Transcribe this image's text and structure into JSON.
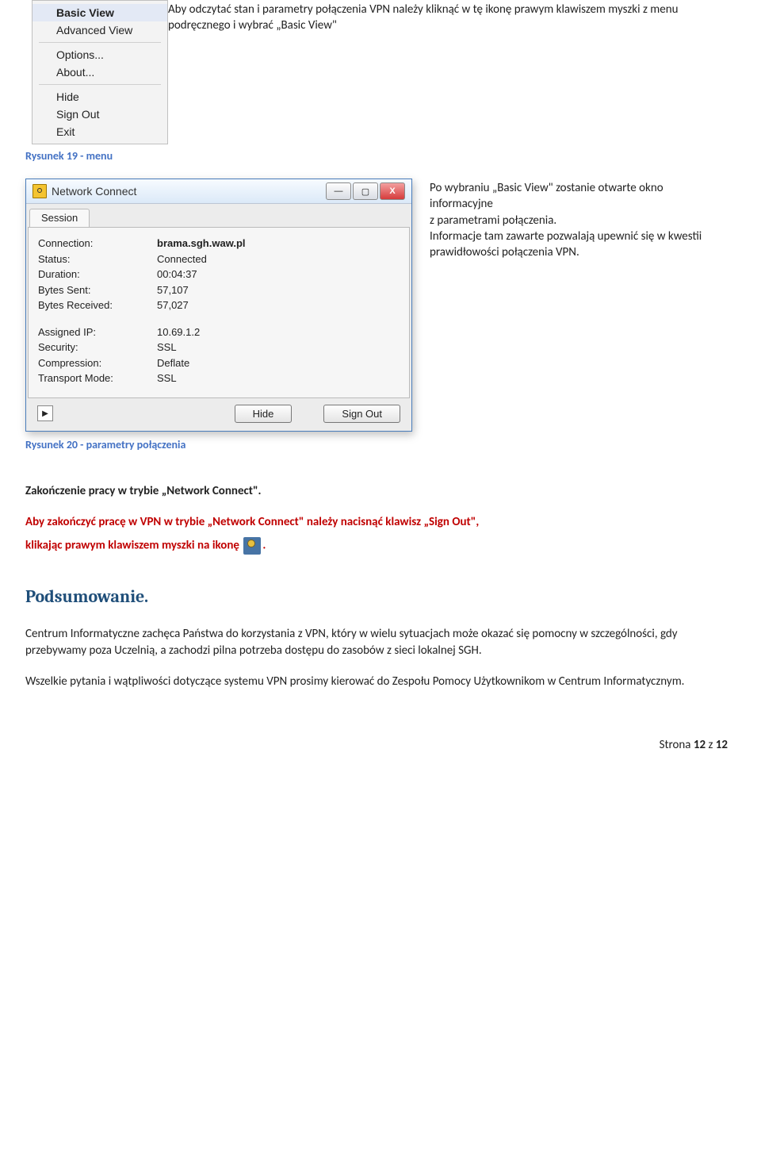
{
  "context_menu": {
    "items": [
      "Basic View",
      "Advanced View",
      "Options...",
      "About...",
      "Hide",
      "Sign Out",
      "Exit"
    ]
  },
  "intro_para": "Aby odczytać stan i parametry połączenia VPN należy kliknąć w tę ikonę prawym klawiszem myszki z menu podręcznego i wybrać „Basic View\"",
  "caption_19": "Rysunek 19 - menu",
  "dialog": {
    "title": "Network Connect",
    "tab": "Session",
    "rows1": [
      {
        "k": "Connection:",
        "v": "brama.sgh.waw.pl",
        "bold": true
      },
      {
        "k": "Status:",
        "v": "Connected"
      },
      {
        "k": "Duration:",
        "v": "00:04:37"
      },
      {
        "k": "Bytes Sent:",
        "v": "57,107"
      },
      {
        "k": "Bytes Received:",
        "v": "57,027"
      }
    ],
    "rows2": [
      {
        "k": "Assigned IP:",
        "v": "10.69.1.2"
      },
      {
        "k": "Security:",
        "v": "SSL"
      },
      {
        "k": "Compression:",
        "v": "Deflate"
      },
      {
        "k": "Transport Mode:",
        "v": "SSL"
      }
    ],
    "btn_hide": "Hide",
    "btn_signout": "Sign Out"
  },
  "side_text": {
    "p1": "Po wybraniu „Basic View\" zostanie otwarte okno informacyjne",
    "p2": "z parametrami połączenia.",
    "p3": "Informacje tam zawarte pozwalają upewnić się w kwestii prawidłowości połączenia VPN."
  },
  "caption_20": "Rysunek 20 - parametry połączenia",
  "end_heading": "Zakończenie pracy w trybie „Network Connect\".",
  "red_line_a": "Aby zakończyć pracę w VPN w trybie „Network Connect\" należy nacisnąć klawisz „Sign Out\",",
  "red_line_b": "klikając prawym klawiszem myszki na ikonę ",
  "red_line_c": ".",
  "summary_heading": "Podsumowanie.",
  "summary_p1": "Centrum Informatyczne zachęca Państwa do korzystania z VPN, który w wielu sytuacjach może okazać się pomocny w szczególności, gdy przebywamy poza Uczelnią, a zachodzi pilna potrzeba dostępu do zasobów z sieci lokalnej SGH.",
  "summary_p2": "Wszelkie pytania i wątpliwości dotyczące systemu VPN prosimy kierować do Zespołu Pomocy Użytkownikom w Centrum Informatycznym.",
  "footer_a": "Strona ",
  "footer_b": "12",
  "footer_c": " z ",
  "footer_d": "12"
}
